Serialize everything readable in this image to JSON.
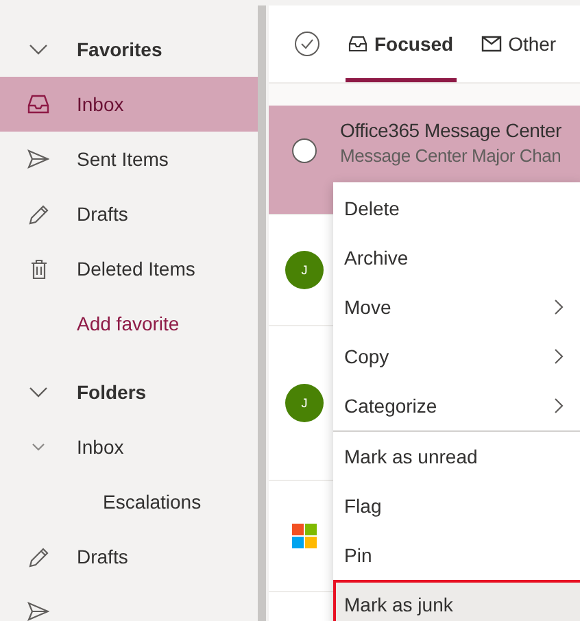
{
  "sidebar": {
    "sections": [
      {
        "label": "Favorites",
        "expanded": true,
        "items": [
          {
            "kind": "inbox",
            "label": "Inbox",
            "selected": true
          },
          {
            "kind": "sent",
            "label": "Sent Items",
            "selected": false
          },
          {
            "kind": "drafts",
            "label": "Drafts",
            "selected": false
          },
          {
            "kind": "deleted",
            "label": "Deleted Items",
            "selected": false
          },
          {
            "kind": "link",
            "label": "Add favorite",
            "selected": false
          }
        ]
      },
      {
        "label": "Folders",
        "expanded": true,
        "items": [
          {
            "kind": "folder",
            "label": "Inbox",
            "selected": false,
            "expanded": true,
            "children": [
              {
                "label": "Escalations",
                "selected": false
              }
            ]
          },
          {
            "kind": "drafts",
            "label": "Drafts",
            "selected": false
          },
          {
            "kind": "sent",
            "selected": false
          }
        ]
      }
    ]
  },
  "tabs": [
    {
      "label": "Focused",
      "kind": "focused",
      "selected": true
    },
    {
      "label": "Other",
      "kind": "other",
      "selected": false
    }
  ],
  "messages": [
    {
      "kind": "radio",
      "sender": "Office365 Message Center",
      "preview": "Message Center Major Chan",
      "selected": true
    },
    {
      "kind": "initial",
      "initial": "J",
      "selected": false
    },
    {
      "kind": "initial",
      "initial": "J",
      "selected": false
    },
    {
      "kind": "logo",
      "selected": false
    }
  ],
  "context_menu": {
    "items": [
      {
        "label": "Delete",
        "submenu": false,
        "divider_before": false,
        "selected": false
      },
      {
        "label": "Archive",
        "submenu": false,
        "divider_before": false,
        "selected": false
      },
      {
        "label": "Move",
        "submenu": true,
        "divider_before": false,
        "selected": false
      },
      {
        "label": "Copy",
        "submenu": true,
        "divider_before": false,
        "selected": false
      },
      {
        "label": "Categorize",
        "submenu": true,
        "divider_before": false,
        "selected": false
      },
      {
        "label": "Mark as unread",
        "submenu": false,
        "divider_before": true,
        "selected": false
      },
      {
        "label": "Flag",
        "submenu": false,
        "divider_before": false,
        "selected": false
      },
      {
        "label": "Pin",
        "submenu": false,
        "divider_before": false,
        "selected": false
      },
      {
        "label": "Mark as junk",
        "submenu": false,
        "divider_before": false,
        "selected": true
      }
    ]
  }
}
